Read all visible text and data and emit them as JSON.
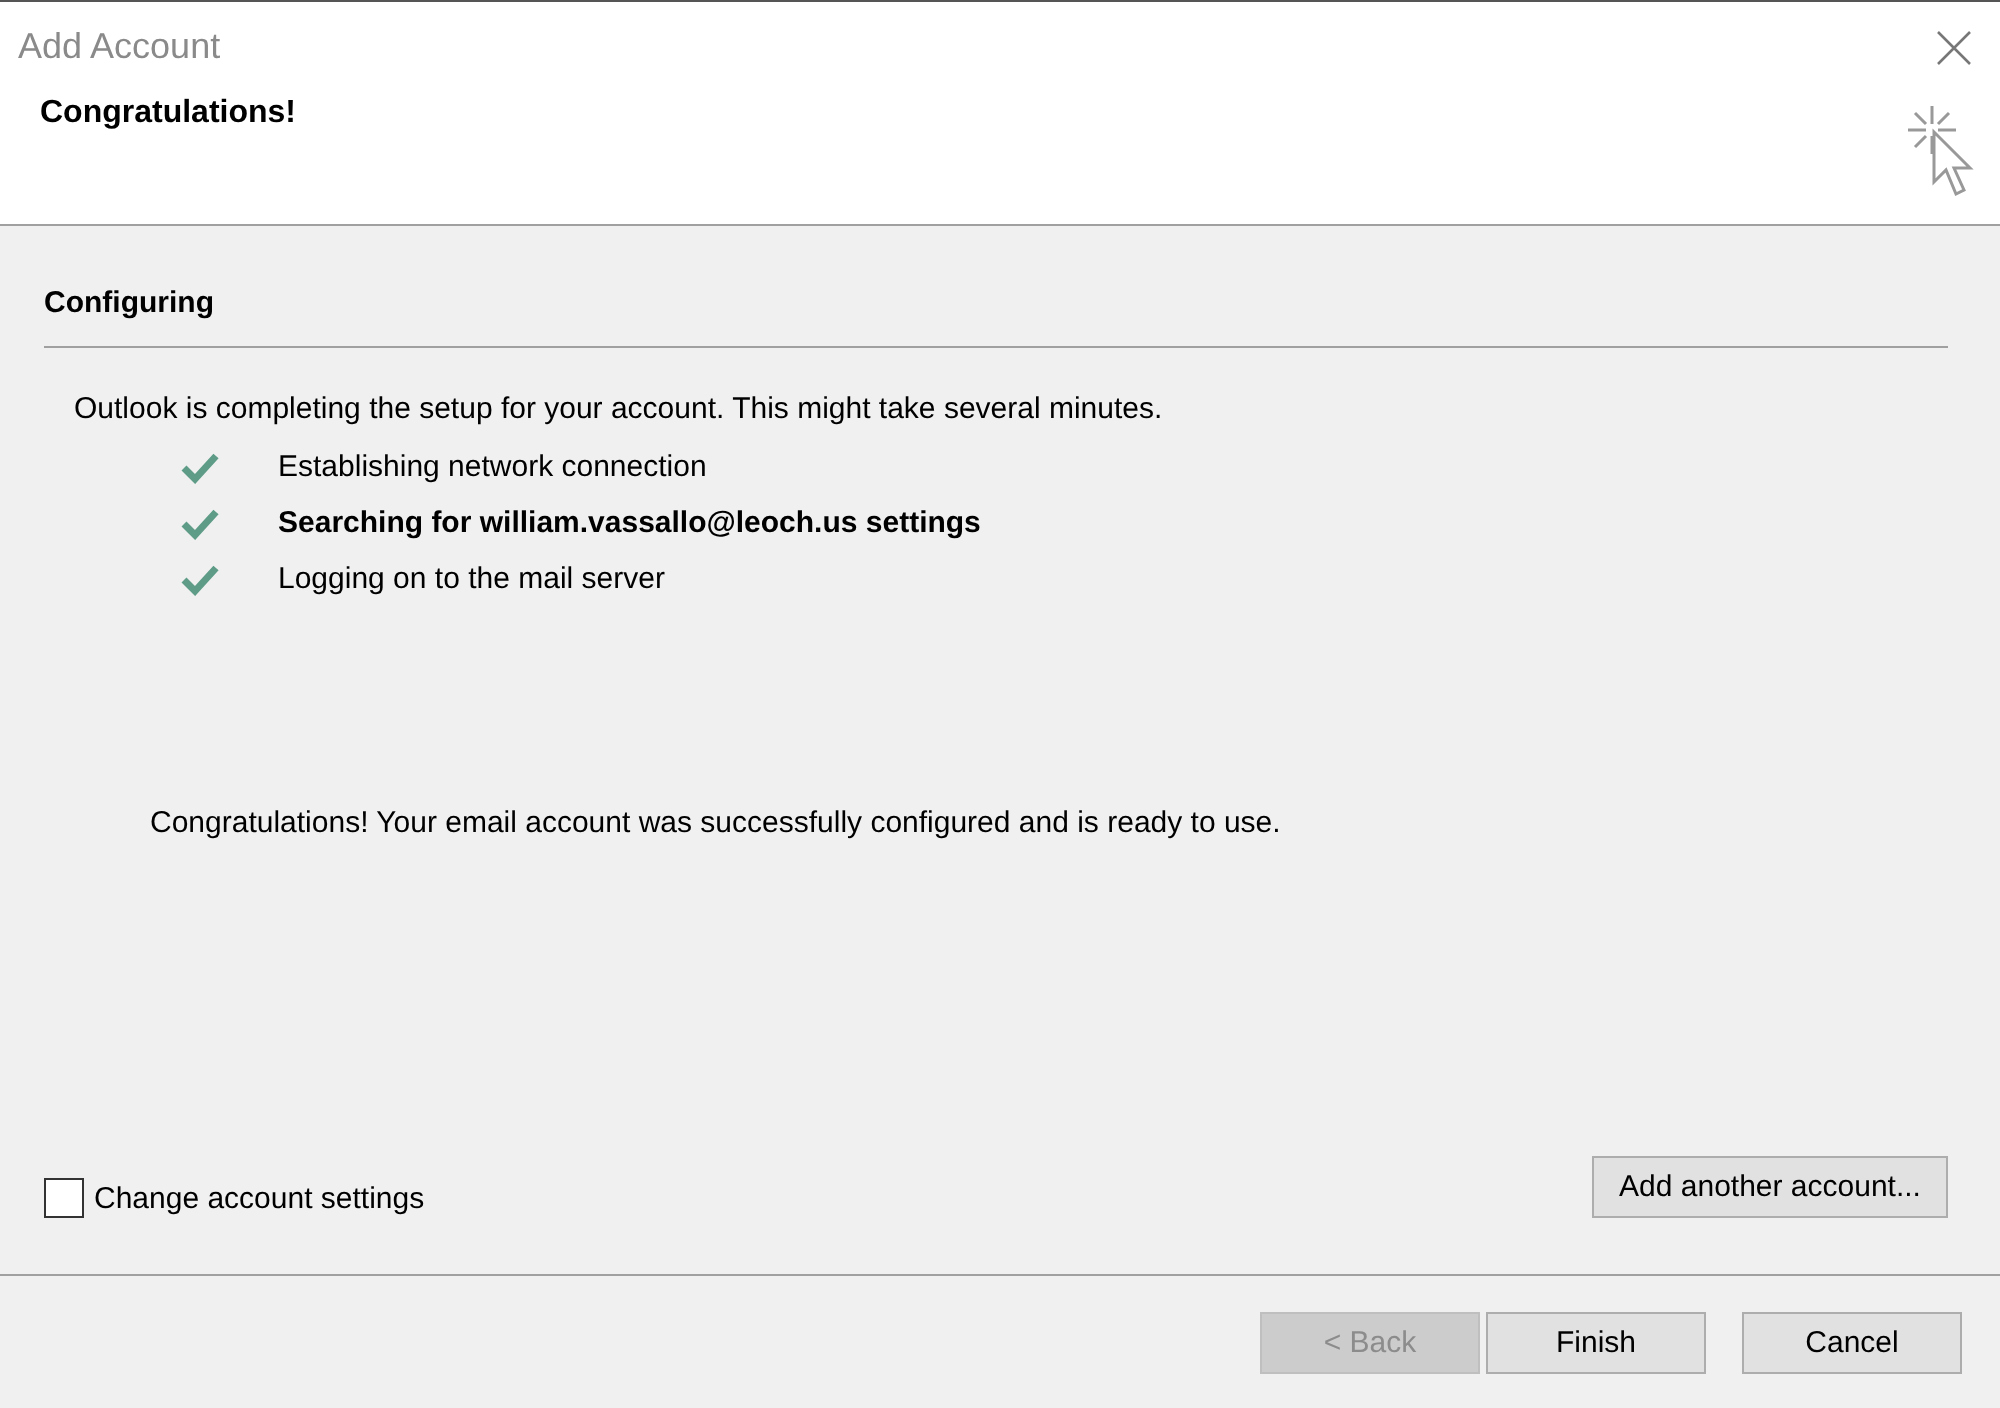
{
  "window": {
    "title": "Add Account"
  },
  "header": {
    "title": "Congratulations!"
  },
  "section": {
    "title": "Configuring"
  },
  "intro": "Outlook is completing the setup for your account. This might take several minutes.",
  "steps": [
    {
      "label": "Establishing network connection",
      "done": true,
      "current": false
    },
    {
      "label": "Searching for william.vassallo@leoch.us settings",
      "done": true,
      "current": true
    },
    {
      "label": "Logging on to the mail server",
      "done": true,
      "current": false
    }
  ],
  "message": "Congratulations! Your email account was successfully configured and is ready to use.",
  "change_settings": {
    "label": "Change account settings",
    "checked": false
  },
  "add_another_button": {
    "label": "Add another account..."
  },
  "buttons": [
    {
      "label": "< Back",
      "disabled": true
    },
    {
      "label": "Finish",
      "disabled": false
    },
    {
      "label": "Cancel",
      "disabled": false
    }
  ]
}
